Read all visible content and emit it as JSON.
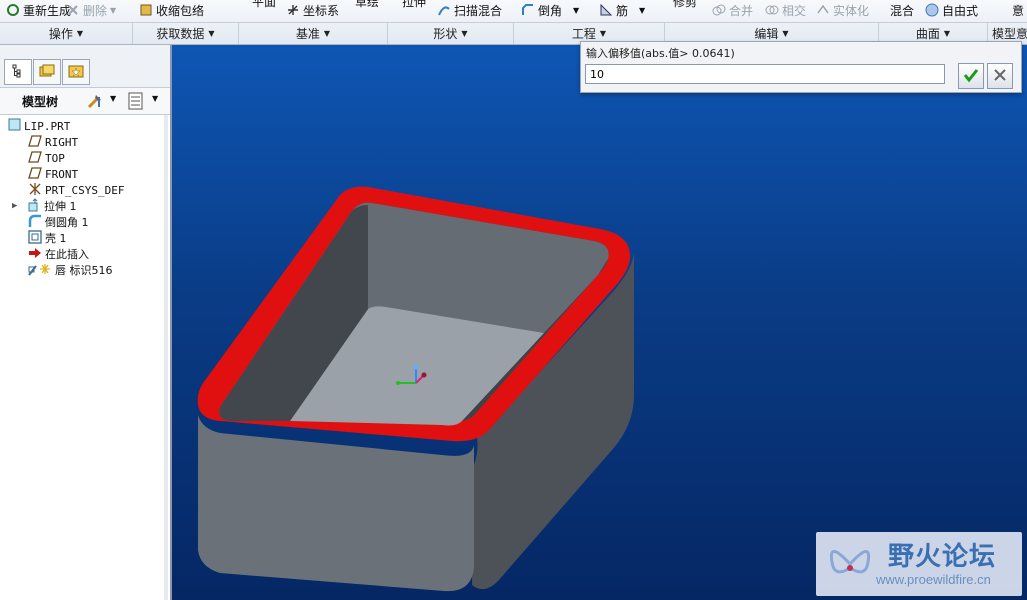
{
  "toolbar": {
    "items": [
      {
        "label": "重新生成",
        "icon": "regenerate-icon"
      },
      {
        "label": "删除",
        "icon": "delete-icon",
        "disabled": true
      },
      {
        "label": "收缩包络",
        "icon": "shrinkwrap-icon"
      },
      {
        "label": "平面",
        "icon": "plane-icon"
      },
      {
        "label": "坐标系",
        "icon": "csys-icon"
      },
      {
        "label": "草绘",
        "icon": "sketch-icon"
      },
      {
        "label": "拉伸",
        "icon": "extrude-icon"
      },
      {
        "label": "扫描混合",
        "icon": "swept-blend-icon"
      },
      {
        "label": "倒角",
        "icon": "chamfer-icon"
      },
      {
        "label": "筋",
        "icon": "rib-icon"
      },
      {
        "label": "修剪",
        "icon": "trim-icon"
      },
      {
        "label": "合并",
        "icon": "merge-icon",
        "disabled": true
      },
      {
        "label": "相交",
        "icon": "intersect-icon",
        "disabled": true
      },
      {
        "label": "实体化",
        "icon": "solidify-icon",
        "disabled": true
      },
      {
        "label": "混合",
        "icon": "blend-icon"
      },
      {
        "label": "自由式",
        "icon": "freestyle-icon"
      },
      {
        "label": "意",
        "icon": "model-intent-icon"
      }
    ]
  },
  "groups": [
    "操作",
    "获取数据",
    "基准",
    "形状",
    "工程",
    "编辑",
    "曲面",
    "模型意"
  ],
  "panel": {
    "tree_title": "模型树",
    "tree": [
      {
        "label": "LIP.PRT",
        "icon": "part-icon"
      },
      {
        "label": "RIGHT",
        "icon": "datum-plane-icon"
      },
      {
        "label": "TOP",
        "icon": "datum-plane-icon"
      },
      {
        "label": "FRONT",
        "icon": "datum-plane-icon"
      },
      {
        "label": "PRT_CSYS_DEF",
        "icon": "csys-icon"
      },
      {
        "label": "拉伸 1",
        "icon": "extrude-icon"
      },
      {
        "label": "倒圆角 1",
        "icon": "round-icon"
      },
      {
        "label": "壳 1",
        "icon": "shell-icon"
      },
      {
        "label": "在此插入",
        "icon": "insert-here-icon"
      },
      {
        "label": "唇 标识516",
        "icon": "lip-icon"
      }
    ]
  },
  "dialog": {
    "prompt": "输入偏移值(abs.值> 0.0641)",
    "value": "10"
  },
  "watermark": {
    "title": "野火论坛",
    "url": "www.proewildfire.cn"
  },
  "colors": {
    "lip": "#e01010",
    "model": "#606770",
    "background_top": "#0e56b4",
    "background_bottom": "#052764"
  }
}
